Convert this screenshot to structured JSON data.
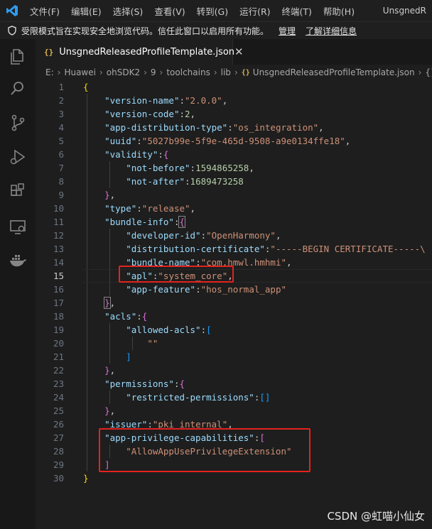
{
  "titlebar": {
    "menu": [
      "文件(F)",
      "编辑(E)",
      "选择(S)",
      "查看(V)",
      "转到(G)",
      "运行(R)",
      "终端(T)",
      "帮助(H)"
    ],
    "window_title": "UnsgnedR"
  },
  "banner": {
    "message": "受限模式旨在实现安全地浏览代码。信任此窗口以启用所有功能。",
    "manage_link": "管理",
    "details_link": "了解详细信息"
  },
  "tab": {
    "filename": "UnsgnedReleasedProfileTemplate.json",
    "file_icon": "{}"
  },
  "breadcrumb": {
    "items": [
      "E:",
      "Huawei",
      "ohSDK2",
      "9",
      "toolchains",
      "lib",
      "UnsgnedReleasedProfileTemplate.json",
      "{}"
    ]
  },
  "editor": {
    "current_line": 15,
    "lines": [
      {
        "n": "1"
      },
      {
        "n": "2"
      },
      {
        "n": "3"
      },
      {
        "n": "4"
      },
      {
        "n": "5"
      },
      {
        "n": "6"
      },
      {
        "n": "7"
      },
      {
        "n": "8"
      },
      {
        "n": "9"
      },
      {
        "n": "10"
      },
      {
        "n": "11"
      },
      {
        "n": "12"
      },
      {
        "n": "13"
      },
      {
        "n": "14"
      },
      {
        "n": "15"
      },
      {
        "n": "16"
      },
      {
        "n": "17"
      },
      {
        "n": "18"
      },
      {
        "n": "19"
      },
      {
        "n": "20"
      },
      {
        "n": "21"
      },
      {
        "n": "22"
      },
      {
        "n": "23"
      },
      {
        "n": "24"
      },
      {
        "n": "25"
      },
      {
        "n": "26"
      },
      {
        "n": "27"
      },
      {
        "n": "28"
      },
      {
        "n": "29"
      },
      {
        "n": "30"
      }
    ],
    "tokens": {
      "version_name_key": "\"version-name\"",
      "version_name_val": "\"2.0.0\"",
      "version_code_key": "\"version-code\"",
      "version_code_val": "2",
      "adt_key": "\"app-distribution-type\"",
      "adt_val": "\"os_integration\"",
      "uuid_key": "\"uuid\"",
      "uuid_val": "\"5027b99e-5f9e-465d-9508-a9e0134ffe18\"",
      "validity_key": "\"validity\"",
      "not_before_key": "\"not-before\"",
      "not_before_val": "1594865258",
      "not_after_key": "\"not-after\"",
      "not_after_val": "1689473258",
      "type_key": "\"type\"",
      "type_val": "\"release\"",
      "bundle_info_key": "\"bundle-info\"",
      "developer_id_key": "\"developer-id\"",
      "developer_id_val": "\"OpenHarmony\"",
      "dist_cert_key": "\"distribution-certificate\"",
      "dist_cert_val": "\"-----BEGIN CERTIFICATE-----\\",
      "bundle_name_key": "\"bundle-name\"",
      "bundle_name_val": "\"com.hmwl.hmhmi\"",
      "apl_key": "\"apl\"",
      "apl_val": "\"system_core\"",
      "app_feature_key": "\"app-feature\"",
      "app_feature_val": "\"hos_normal_app\"",
      "acls_key": "\"acls\"",
      "allowed_acls_key": "\"allowed-acls\"",
      "empty_string": "\"\"",
      "permissions_key": "\"permissions\"",
      "restricted_permissions_key": "\"restricted-permissions\"",
      "issuer_key": "\"issuer\"",
      "issuer_val": "\"pki_internal\"",
      "apc_key": "\"app-privilege-capabilities\"",
      "apc_val": "\"AllowAppUsePrivilegeExtension\""
    }
  },
  "watermark": "CSDN @虹喵小仙女",
  "colors": {
    "key": "#9cdcfe",
    "string": "#ce9178",
    "number": "#b5cea8",
    "highlight_box": "#e3231f",
    "accent": "#007acc"
  }
}
